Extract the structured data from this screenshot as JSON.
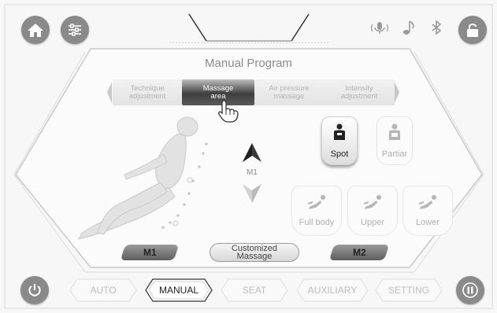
{
  "header": {
    "home_icon": "home-icon",
    "settings_icon": "sliders-icon",
    "voice_icon": "microphone-icon",
    "music_icon": "music-note-icon",
    "bluetooth_icon": "bluetooth-icon",
    "lock_icon": "unlock-icon"
  },
  "panel": {
    "title": "Manual Program",
    "tabs": [
      {
        "label": "Technique adjustment",
        "line1": "Technique",
        "line2": "adjustment",
        "active": false
      },
      {
        "label": "Massage area",
        "line1": "Massage",
        "line2": "area",
        "active": true
      },
      {
        "label": "Air pressure massage",
        "line1": "Air pressure",
        "line2": "massage",
        "active": false
      },
      {
        "label": "Intensity adjustment",
        "line1": "Intensity",
        "line2": "adjustment",
        "active": false
      }
    ],
    "position_label": "M1",
    "area_buttons": [
      {
        "label": "Spot",
        "icon": "person-spot-icon",
        "selected": true
      },
      {
        "label": "Partiar",
        "icon": "person-partial-icon",
        "selected": false
      }
    ],
    "body_buttons": [
      {
        "label": "Full body",
        "icon": "recline-full-icon"
      },
      {
        "label": "Upper",
        "icon": "recline-upper-icon"
      },
      {
        "label": "Lower",
        "icon": "recline-lower-icon"
      }
    ],
    "memory": {
      "m1": "M1",
      "custom_line1": "Customized",
      "custom_line2": "Massage",
      "m2": "M2"
    }
  },
  "nav": {
    "items": [
      {
        "label": "AUTO",
        "active": false
      },
      {
        "label": "MANUAL",
        "active": true
      },
      {
        "label": "SEAT",
        "active": false
      },
      {
        "label": "AUXILIARY",
        "active": false
      },
      {
        "label": "SETTING",
        "active": false
      }
    ],
    "power_icon": "power-icon",
    "pause_icon": "pause-icon"
  },
  "colors": {
    "button_gray": "#8a8a8a",
    "active_tab": "#3e3e3e",
    "inactive_text": "#b3b3b3"
  }
}
